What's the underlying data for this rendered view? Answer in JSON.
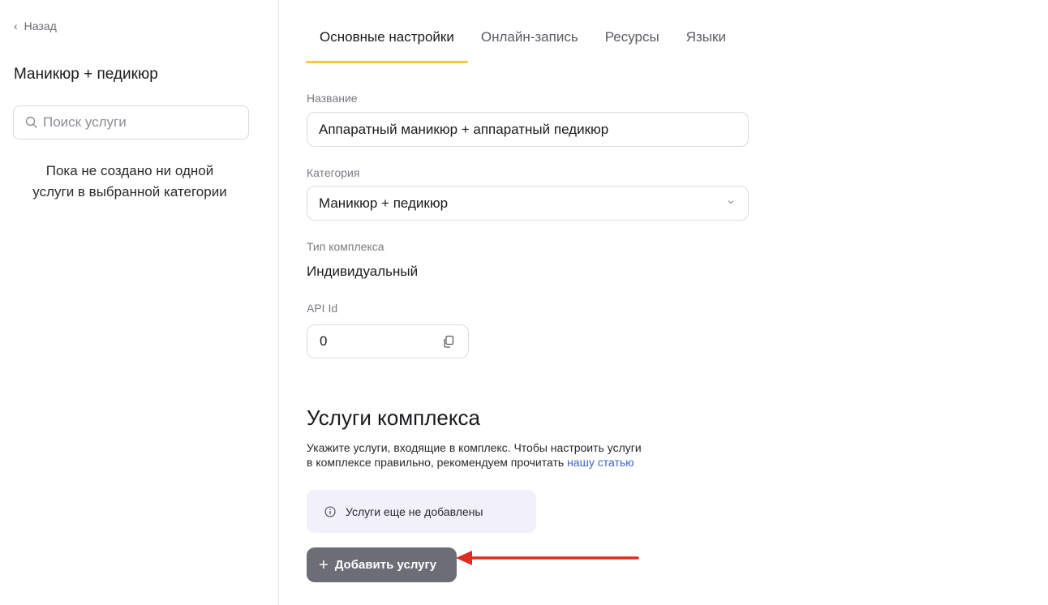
{
  "sidebar": {
    "back_label": "Назад",
    "title": "Маникюр + педикюр",
    "search_placeholder": "Поиск услуги",
    "empty_line1": "Пока не создано ни одной",
    "empty_line2": "услуги в выбранной категории"
  },
  "tabs": [
    {
      "label": "Основные настройки",
      "active": true
    },
    {
      "label": "Онлайн-запись",
      "active": false
    },
    {
      "label": "Ресурсы",
      "active": false
    },
    {
      "label": "Языки",
      "active": false
    }
  ],
  "form": {
    "name_label": "Название",
    "name_value": "Аппаратный маникюр + аппаратный педикюр",
    "category_label": "Категория",
    "category_value": "Маникюр + педикюр",
    "type_label": "Тип комплекса",
    "type_value": "Индивидуальный",
    "api_label": "API Id",
    "api_value": "0"
  },
  "services": {
    "title": "Услуги комплекса",
    "desc_line1": "Укажите услуги, входящие в комплекс. Чтобы настроить услуги",
    "desc_line2_prefix": "в комплексе правильно, рекомендуем прочитать ",
    "desc_link": "нашу статью",
    "info_text": "Услуги еще не добавлены",
    "add_button_label": "Добавить услугу"
  },
  "colors": {
    "tab_underline": "#f5c842",
    "link": "#3a63c9",
    "info_bg": "#f1f0fb",
    "button_bg": "#6b6e74",
    "annotation_arrow": "#e02b22"
  },
  "icons": [
    "chevron-left-icon",
    "search-icon",
    "chevron-down-icon",
    "copy-icon",
    "info-icon",
    "plus-icon",
    "arrow-annotation"
  ]
}
